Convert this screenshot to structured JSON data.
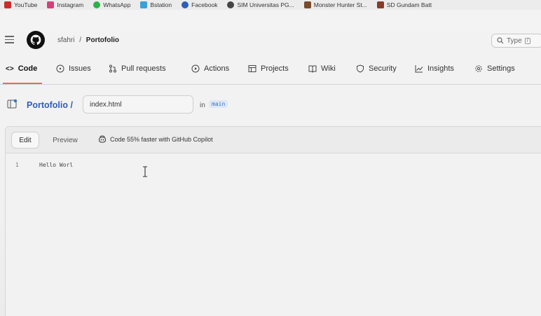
{
  "bookmarks": [
    {
      "label": "YouTube",
      "icon": "youtube-icon",
      "color": "#cc2b2b"
    },
    {
      "label": "Instagram",
      "icon": "instagram-icon",
      "color": "#d6407a"
    },
    {
      "label": "WhatsApp",
      "icon": "whatsapp-icon",
      "color": "#2bb34a"
    },
    {
      "label": "Bstation",
      "icon": "bstation-icon",
      "color": "#3aa0d8"
    },
    {
      "label": "Facebook",
      "icon": "facebook-icon",
      "color": "#2d5fb8"
    },
    {
      "label": "SIM Universitas PG...",
      "icon": "globe-icon",
      "color": "#444444"
    },
    {
      "label": "Monster Hunter St...",
      "icon": "monster-hunter-icon",
      "color": "#7a4a2a"
    },
    {
      "label": "SD Gundam Batt",
      "icon": "gundam-icon",
      "color": "#8a3a2a"
    }
  ],
  "header": {
    "owner": "sfahri",
    "separator": "/",
    "repo": "Portofolio",
    "search_placeholder": "Type"
  },
  "nav": {
    "tabs": [
      {
        "label": "Code",
        "icon": "code-icon",
        "active": true
      },
      {
        "label": "Issues",
        "icon": "issue-icon",
        "active": false
      },
      {
        "label": "Pull requests",
        "icon": "pull-request-icon",
        "active": false
      },
      {
        "label": "Actions",
        "icon": "play-icon",
        "active": false
      },
      {
        "label": "Projects",
        "icon": "table-icon",
        "active": false
      },
      {
        "label": "Wiki",
        "icon": "book-icon",
        "active": false
      },
      {
        "label": "Security",
        "icon": "shield-icon",
        "active": false
      },
      {
        "label": "Insights",
        "icon": "graph-icon",
        "active": false
      },
      {
        "label": "Settings",
        "icon": "gear-icon",
        "active": false
      }
    ]
  },
  "breadcrumb": {
    "root": "Portofolio /",
    "filename": "index.html",
    "in_label": "in",
    "branch": "main"
  },
  "editor": {
    "edit_label": "Edit",
    "preview_label": "Preview",
    "copilot_text": "Code 55% faster with GitHub Copilot",
    "lines": [
      {
        "number": "1",
        "text": "Hello Worl"
      }
    ]
  },
  "colors": {
    "accent_underline": "#e0744d",
    "link_blue": "#2f5fb4",
    "branch_bg": "#dde8f5"
  }
}
